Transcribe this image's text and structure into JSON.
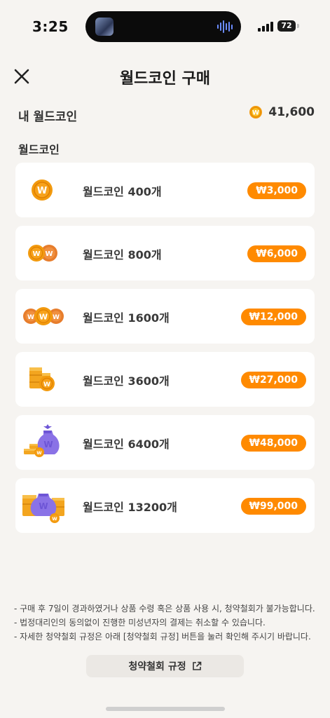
{
  "status": {
    "time": "3:25",
    "battery": "72"
  },
  "header": {
    "title": "월드코인 구매"
  },
  "balance": {
    "label": "내 월드코인",
    "value": "41,600"
  },
  "section": {
    "label": "월드코인"
  },
  "products": [
    {
      "name": "월드코인 400개",
      "price": "₩3,000",
      "icon": "single-coin-icon"
    },
    {
      "name": "월드코인 800개",
      "price": "₩6,000",
      "icon": "two-coins-icon"
    },
    {
      "name": "월드코인 1600개",
      "price": "₩12,000",
      "icon": "three-coins-icon"
    },
    {
      "name": "월드코인 3600개",
      "price": "₩27,000",
      "icon": "coin-stack-icon"
    },
    {
      "name": "월드코인 6400개",
      "price": "₩48,000",
      "icon": "coin-bag-icon"
    },
    {
      "name": "월드코인 13200개",
      "price": "₩99,000",
      "icon": "coin-treasure-icon"
    }
  ],
  "notes": [
    "- 구매 후 7일이 경과하였거나 상품 수령 혹은 상품 사용 시, 청약철회가 불가능합니다.",
    "- 법정대리인의 동의없이 진행한 미성년자의 결제는 취소할 수 있습니다.",
    "- 자세한 청약철회 규정은 아래 [청약철회 규정] 버튼을 눌러 확인해 주시기 바랍니다."
  ],
  "rules_button": {
    "label": "청약철회 규정"
  },
  "colors": {
    "accent": "#ff8a00",
    "coin": "#f7a21b",
    "bag": "#8a72e6"
  }
}
